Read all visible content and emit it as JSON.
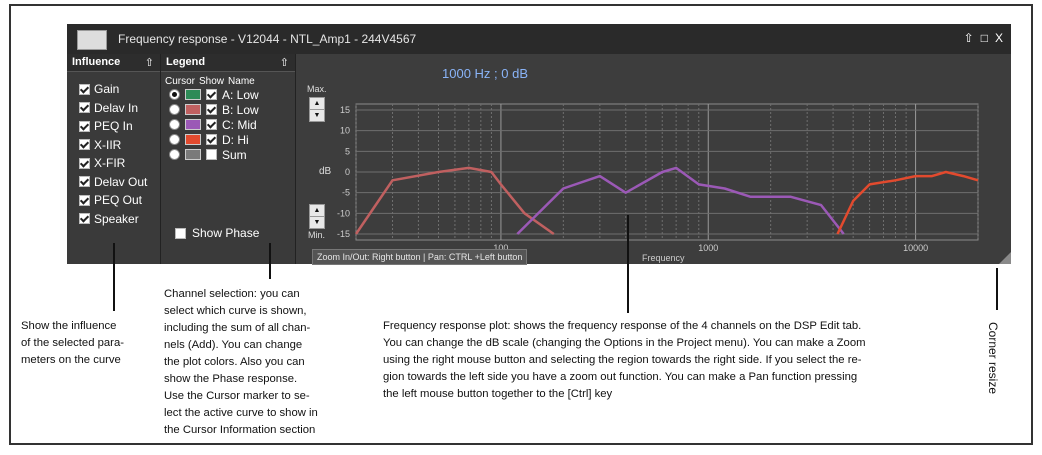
{
  "window": {
    "title": "Frequency response - V12044 - NTL_Amp1 - 244V4567",
    "controls": [
      "⇧",
      "□",
      "X"
    ]
  },
  "influence": {
    "header": "Influence",
    "pin": "⇧",
    "items": [
      {
        "label": "Gain",
        "checked": true
      },
      {
        "label": "Delav In",
        "checked": true
      },
      {
        "label": "PEQ In",
        "checked": true
      },
      {
        "label": "X-IIR",
        "checked": true
      },
      {
        "label": "X-FIR",
        "checked": true
      },
      {
        "label": "Delav Out",
        "checked": true
      },
      {
        "label": "PEQ Out",
        "checked": true
      },
      {
        "label": "Speaker",
        "checked": true
      }
    ]
  },
  "legend": {
    "header": "Legend",
    "pin": "⇧",
    "col_cursor": "Cursor",
    "col_show": "Show",
    "col_name": "Name",
    "channels": [
      {
        "name": "A: Low",
        "color": "#2e8b57",
        "cursor": true,
        "show": true
      },
      {
        "name": "B: Low",
        "color": "#c06060",
        "cursor": false,
        "show": true
      },
      {
        "name": "C: Mid",
        "color": "#9b59b6",
        "cursor": false,
        "show": true
      },
      {
        "name": "D: Hi",
        "color": "#e24a2e",
        "cursor": false,
        "show": true
      },
      {
        "name": "Sum",
        "color": "#7a7a7a",
        "cursor": false,
        "show": false
      }
    ],
    "show_phase": "Show Phase"
  },
  "plot": {
    "cursor_readout": "1000 Hz ; 0 dB",
    "max_label": "Max.",
    "min_label": "Min.",
    "db_label": "dB",
    "x_label": "Frequency",
    "y_ticks": [
      "15",
      "10",
      "5",
      "0",
      "-5",
      "-10",
      "-15"
    ],
    "x_ticks": [
      "100",
      "1000",
      "10000"
    ],
    "status": "Zoom In/Out: Right button | Pan: CTRL +Left button",
    "colors": {
      "B": "#c06060",
      "C": "#9b59b6",
      "D": "#e24a2e"
    }
  },
  "chart_data": {
    "type": "line",
    "title": "",
    "xlabel": "Frequency",
    "ylabel": "dB",
    "xscale": "log",
    "xlim": [
      20,
      20000
    ],
    "ylim": [
      -15,
      15
    ],
    "grid": true,
    "series": [
      {
        "name": "B: Low",
        "x": [
          20,
          30,
          50,
          70,
          90,
          100,
          130,
          180
        ],
        "y": [
          -15,
          -2,
          0,
          1,
          0,
          -3,
          -10,
          -15
        ]
      },
      {
        "name": "C: Mid",
        "x": [
          120,
          200,
          300,
          400,
          600,
          700,
          900,
          1200,
          1600,
          2500,
          3500,
          4500
        ],
        "y": [
          -15,
          -4,
          -1,
          -5,
          0,
          1,
          -3,
          -4,
          -6,
          -6,
          -8,
          -15
        ]
      },
      {
        "name": "D: Hi",
        "x": [
          4200,
          5000,
          6000,
          8000,
          10000,
          12000,
          14000,
          17000,
          20000
        ],
        "y": [
          -15,
          -7,
          -3,
          -2,
          -1,
          -1,
          0,
          -1,
          -2
        ]
      }
    ]
  },
  "annotations": {
    "influence": "Show the influence of the selected parameters on the curve",
    "influence_lines": [
      "Show the influence",
      "of the selected para-",
      "meters on the curve"
    ],
    "channel": [
      "Channel selection: you can",
      "select which curve is shown,",
      "including the sum of all chan-",
      "nels (Add). You can change",
      "the plot colors. Also you can",
      "show the Phase response.",
      "Use the Cursor marker to se-",
      "lect the active curve to show in",
      "the Cursor Information section"
    ],
    "frequency": [
      "Frequency response plot: shows the frequency response of the 4 channels on the DSP Edit tab.",
      "You can change the dB scale (changing the Options in the Project menu). You can make a Zoom",
      "using the right mouse button and selecting the region towards the right side. If you select the re-",
      "gion towards the left side you have a zoom out function. You can make a Pan function pressing",
      "the left mouse button together to the [Ctrl] key"
    ],
    "corner": "Corner resize"
  }
}
